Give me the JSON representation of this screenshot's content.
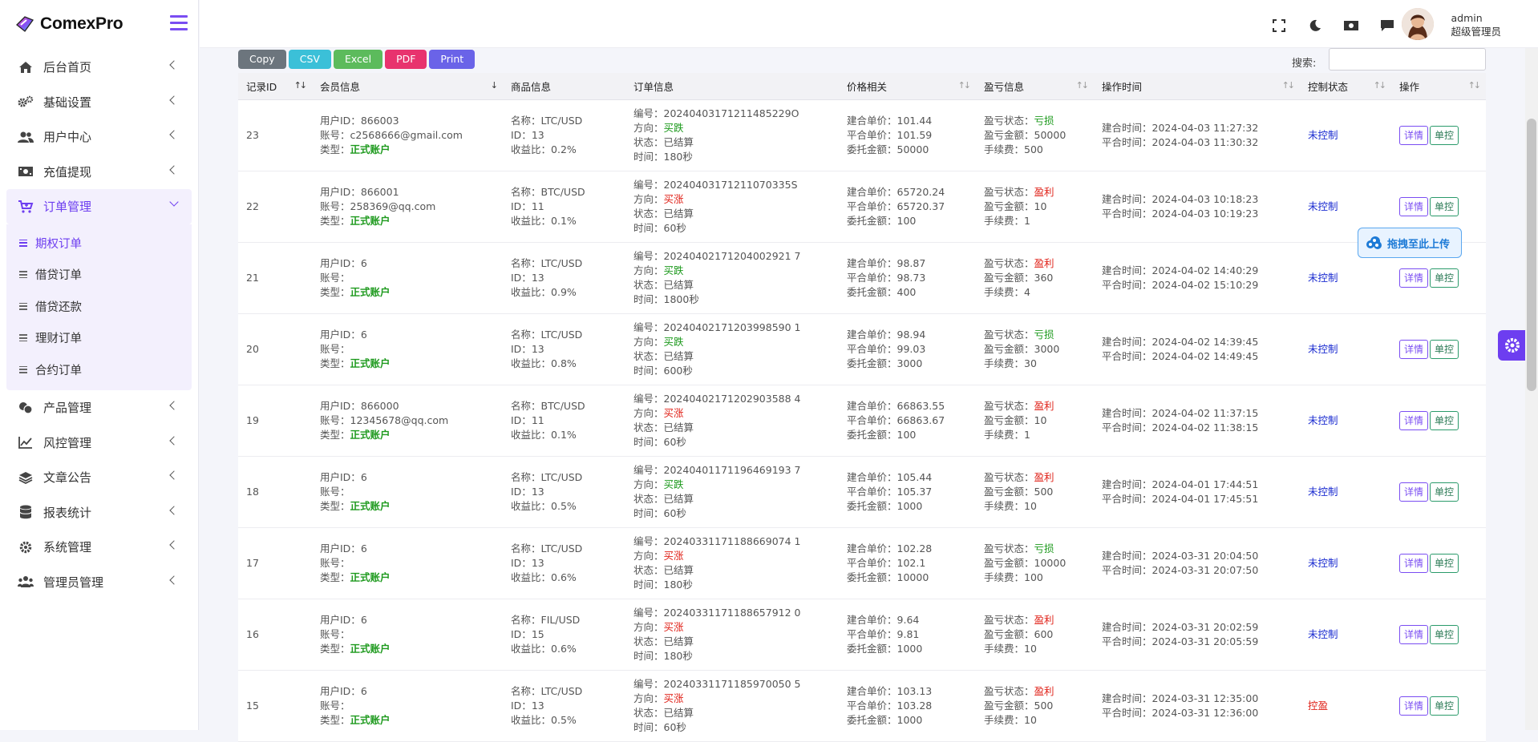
{
  "app": {
    "name": "ComexPro"
  },
  "sidebar": {
    "items": [
      {
        "label": "后台首页"
      },
      {
        "label": "基础设置"
      },
      {
        "label": "用户中心"
      },
      {
        "label": "充值提现"
      },
      {
        "label": "订单管理"
      },
      {
        "label": "产品管理"
      },
      {
        "label": "风控管理"
      },
      {
        "label": "文章公告"
      },
      {
        "label": "报表统计"
      },
      {
        "label": "系统管理"
      },
      {
        "label": "管理员管理"
      }
    ],
    "submenu": [
      {
        "label": "期权订单"
      },
      {
        "label": "借贷订单"
      },
      {
        "label": "借贷还款"
      },
      {
        "label": "理财订单"
      },
      {
        "label": "合约订单"
      }
    ]
  },
  "header": {
    "username": "admin",
    "role": "超级管理员"
  },
  "toolbar": {
    "buttons": [
      {
        "label": "Copy",
        "color": "#6c757d"
      },
      {
        "label": "CSV",
        "color": "#3bc0d8"
      },
      {
        "label": "Excel",
        "color": "#5cbb5c"
      },
      {
        "label": "PDF",
        "color": "#e8336e"
      },
      {
        "label": "Print",
        "color": "#6a63e8"
      }
    ],
    "search_label": "搜索:"
  },
  "table": {
    "headers": [
      "记录ID",
      "会员信息",
      "商品信息",
      "订单信息",
      "价格相关",
      "盈亏信息",
      "操作时间",
      "控制状态",
      "操作"
    ],
    "field_labels": {
      "uid": "用户ID：",
      "account": "账号：",
      "type": "类型：",
      "name": "名称：",
      "pid": "ID：",
      "ratio": "收益比：",
      "no": "编号：",
      "dir": "方向：",
      "status": "状态：",
      "time": "时间：",
      "open_price": "建合单价：",
      "close_price": "平合单价：",
      "amount": "委托金额：",
      "pl_status": "盈亏状态：",
      "pl_amount": "盈亏金额：",
      "fee": "手续费：",
      "open_time": "建合时间：",
      "close_time": "平合时间："
    },
    "action_detail": "详情",
    "action_control": "单控",
    "rows": [
      {
        "id": "23",
        "uid": "866003",
        "account": "c2568666@gmail.com",
        "type": "正式账户",
        "name": "LTC/USD",
        "pid": "13",
        "ratio": "0.2%",
        "no": "20240403171211485229O",
        "dir": "买跌",
        "dir_c": "g",
        "status": "已结算",
        "time": "180秒",
        "open_price": "101.44",
        "close_price": "101.59",
        "amount": "50000",
        "pl_status": "亏损",
        "pl_c": "g",
        "pl_amount": "50000",
        "fee": "500",
        "open_time": "2024-04-03 11:27:32",
        "close_time": "2024-04-03 11:30:32",
        "ctrl": "未控制",
        "ctrl_c": ""
      },
      {
        "id": "22",
        "uid": "866001",
        "account": "258369@qq.com",
        "type": "正式账户",
        "name": "BTC/USD",
        "pid": "11",
        "ratio": "0.1%",
        "no": "20240403171211070335S",
        "dir": "买涨",
        "dir_c": "r",
        "status": "已结算",
        "time": "60秒",
        "open_price": "65720.24",
        "close_price": "65720.37",
        "amount": "100",
        "pl_status": "盈利",
        "pl_c": "r",
        "pl_amount": "10",
        "fee": "1",
        "open_time": "2024-04-03 10:18:23",
        "close_time": "2024-04-03 10:19:23",
        "ctrl": "未控制",
        "ctrl_c": ""
      },
      {
        "id": "21",
        "uid": "6",
        "account": "",
        "type": "正式账户",
        "name": "LTC/USD",
        "pid": "13",
        "ratio": "0.9%",
        "no": "20240402171204002921 7",
        "dir": "买跌",
        "dir_c": "g",
        "status": "已结算",
        "time": "1800秒",
        "open_price": "98.87",
        "close_price": "98.73",
        "amount": "400",
        "pl_status": "盈利",
        "pl_c": "r",
        "pl_amount": "360",
        "fee": "4",
        "open_time": "2024-04-02 14:40:29",
        "close_time": "2024-04-02 15:10:29",
        "ctrl": "未控制",
        "ctrl_c": ""
      },
      {
        "id": "20",
        "uid": "6",
        "account": "",
        "type": "正式账户",
        "name": "LTC/USD",
        "pid": "13",
        "ratio": "0.8%",
        "no": "20240402171203998590 1",
        "dir": "买跌",
        "dir_c": "g",
        "status": "已结算",
        "time": "600秒",
        "open_price": "98.94",
        "close_price": "99.03",
        "amount": "3000",
        "pl_status": "亏损",
        "pl_c": "g",
        "pl_amount": "3000",
        "fee": "30",
        "open_time": "2024-04-02 14:39:45",
        "close_time": "2024-04-02 14:49:45",
        "ctrl": "未控制",
        "ctrl_c": ""
      },
      {
        "id": "19",
        "uid": "866000",
        "account": "12345678@qq.com",
        "type": "正式账户",
        "name": "BTC/USD",
        "pid": "11",
        "ratio": "0.1%",
        "no": "20240402171202903588 4",
        "dir": "买涨",
        "dir_c": "r",
        "status": "已结算",
        "time": "60秒",
        "open_price": "66863.55",
        "close_price": "66863.67",
        "amount": "100",
        "pl_status": "盈利",
        "pl_c": "r",
        "pl_amount": "10",
        "fee": "1",
        "open_time": "2024-04-02 11:37:15",
        "close_time": "2024-04-02 11:38:15",
        "ctrl": "未控制",
        "ctrl_c": ""
      },
      {
        "id": "18",
        "uid": "6",
        "account": "",
        "type": "正式账户",
        "name": "LTC/USD",
        "pid": "13",
        "ratio": "0.5%",
        "no": "20240401171196469193 7",
        "dir": "买跌",
        "dir_c": "g",
        "status": "已结算",
        "time": "60秒",
        "open_price": "105.44",
        "close_price": "105.37",
        "amount": "1000",
        "pl_status": "盈利",
        "pl_c": "r",
        "pl_amount": "500",
        "fee": "10",
        "open_time": "2024-04-01 17:44:51",
        "close_time": "2024-04-01 17:45:51",
        "ctrl": "未控制",
        "ctrl_c": ""
      },
      {
        "id": "17",
        "uid": "6",
        "account": "",
        "type": "正式账户",
        "name": "LTC/USD",
        "pid": "13",
        "ratio": "0.6%",
        "no": "20240331171188669074 1",
        "dir": "买涨",
        "dir_c": "r",
        "status": "已结算",
        "time": "180秒",
        "open_price": "102.28",
        "close_price": "102.1",
        "amount": "10000",
        "pl_status": "亏损",
        "pl_c": "g",
        "pl_amount": "10000",
        "fee": "100",
        "open_time": "2024-03-31 20:04:50",
        "close_time": "2024-03-31 20:07:50",
        "ctrl": "未控制",
        "ctrl_c": ""
      },
      {
        "id": "16",
        "uid": "6",
        "account": "",
        "type": "正式账户",
        "name": "FIL/USD",
        "pid": "15",
        "ratio": "0.6%",
        "no": "20240331171188657912 0",
        "dir": "买涨",
        "dir_c": "r",
        "status": "已结算",
        "time": "180秒",
        "open_price": "9.64",
        "close_price": "9.81",
        "amount": "1000",
        "pl_status": "盈利",
        "pl_c": "r",
        "pl_amount": "600",
        "fee": "10",
        "open_time": "2024-03-31 20:02:59",
        "close_time": "2024-03-31 20:05:59",
        "ctrl": "未控制",
        "ctrl_c": ""
      },
      {
        "id": "15",
        "uid": "6",
        "account": "",
        "type": "正式账户",
        "name": "LTC/USD",
        "pid": "13",
        "ratio": "0.5%",
        "no": "20240331171185970050 5",
        "dir": "买涨",
        "dir_c": "r",
        "status": "已结算",
        "time": "60秒",
        "open_price": "103.13",
        "close_price": "103.28",
        "amount": "1000",
        "pl_status": "盈利",
        "pl_c": "r",
        "pl_amount": "500",
        "fee": "10",
        "open_time": "2024-03-31 12:35:00",
        "close_time": "2024-03-31 12:36:00",
        "ctrl": "控盈",
        "ctrl_c": "red"
      }
    ]
  },
  "float": {
    "upload_label": "拖拽至此上传"
  }
}
